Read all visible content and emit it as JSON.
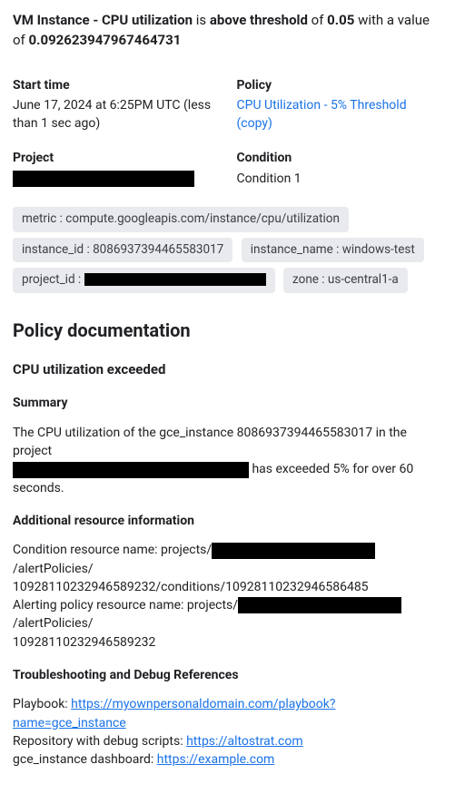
{
  "headline": {
    "b1": "VM Instance - CPU utilization",
    "t1": " is ",
    "b2": "above threshold",
    "t2": " of ",
    "b3": "0.05",
    "t3": " with a value of ",
    "b4": "0.092623947967464731"
  },
  "info": {
    "start_label": "Start time",
    "start_value": "June 17, 2024 at 6:25PM UTC (less than 1 sec ago)",
    "policy_label": "Policy",
    "policy_link": "CPU Utilization - 5% Threshold (copy)",
    "project_label": "Project",
    "condition_label": "Condition",
    "condition_value": "Condition 1"
  },
  "chips": {
    "metric": "metric : compute.googleapis.com/instance/cpu/utilization",
    "instance_id": "instance_id : 8086937394465583017",
    "instance_name": "instance_name : windows-test",
    "project_id_prefix": "project_id : ",
    "zone": "zone : us-central1-a"
  },
  "doc": {
    "h2": "Policy documentation",
    "h3": "CPU utilization exceeded",
    "summary_h": "Summary",
    "summary_1": "The CPU utilization of the gce_instance 8086937394465583017 in the project ",
    "summary_2": " has exceeded 5% for over 60 seconds.",
    "addl_h": "Additional resource information",
    "cond_1": "Condition resource name: projects/",
    "cond_2": "/alertPolicies/",
    "cond_3": "10928110232946589232/conditions/10928110232946586485",
    "alert_1": "Alerting policy resource name: projects/",
    "alert_2": "/alertPolicies/",
    "alert_3": "10928110232946589232",
    "trouble_h": "Troubleshooting and Debug References",
    "play_label": "Playbook: ",
    "play_link": "https://myownpersonaldomain.com/playbook?name=gce_instance",
    "repo_label": "Repository with debug scripts: ",
    "repo_link": "https://altostrat.com",
    "dash_label": "gce_instance dashboard: ",
    "dash_link": "https://example.com"
  }
}
